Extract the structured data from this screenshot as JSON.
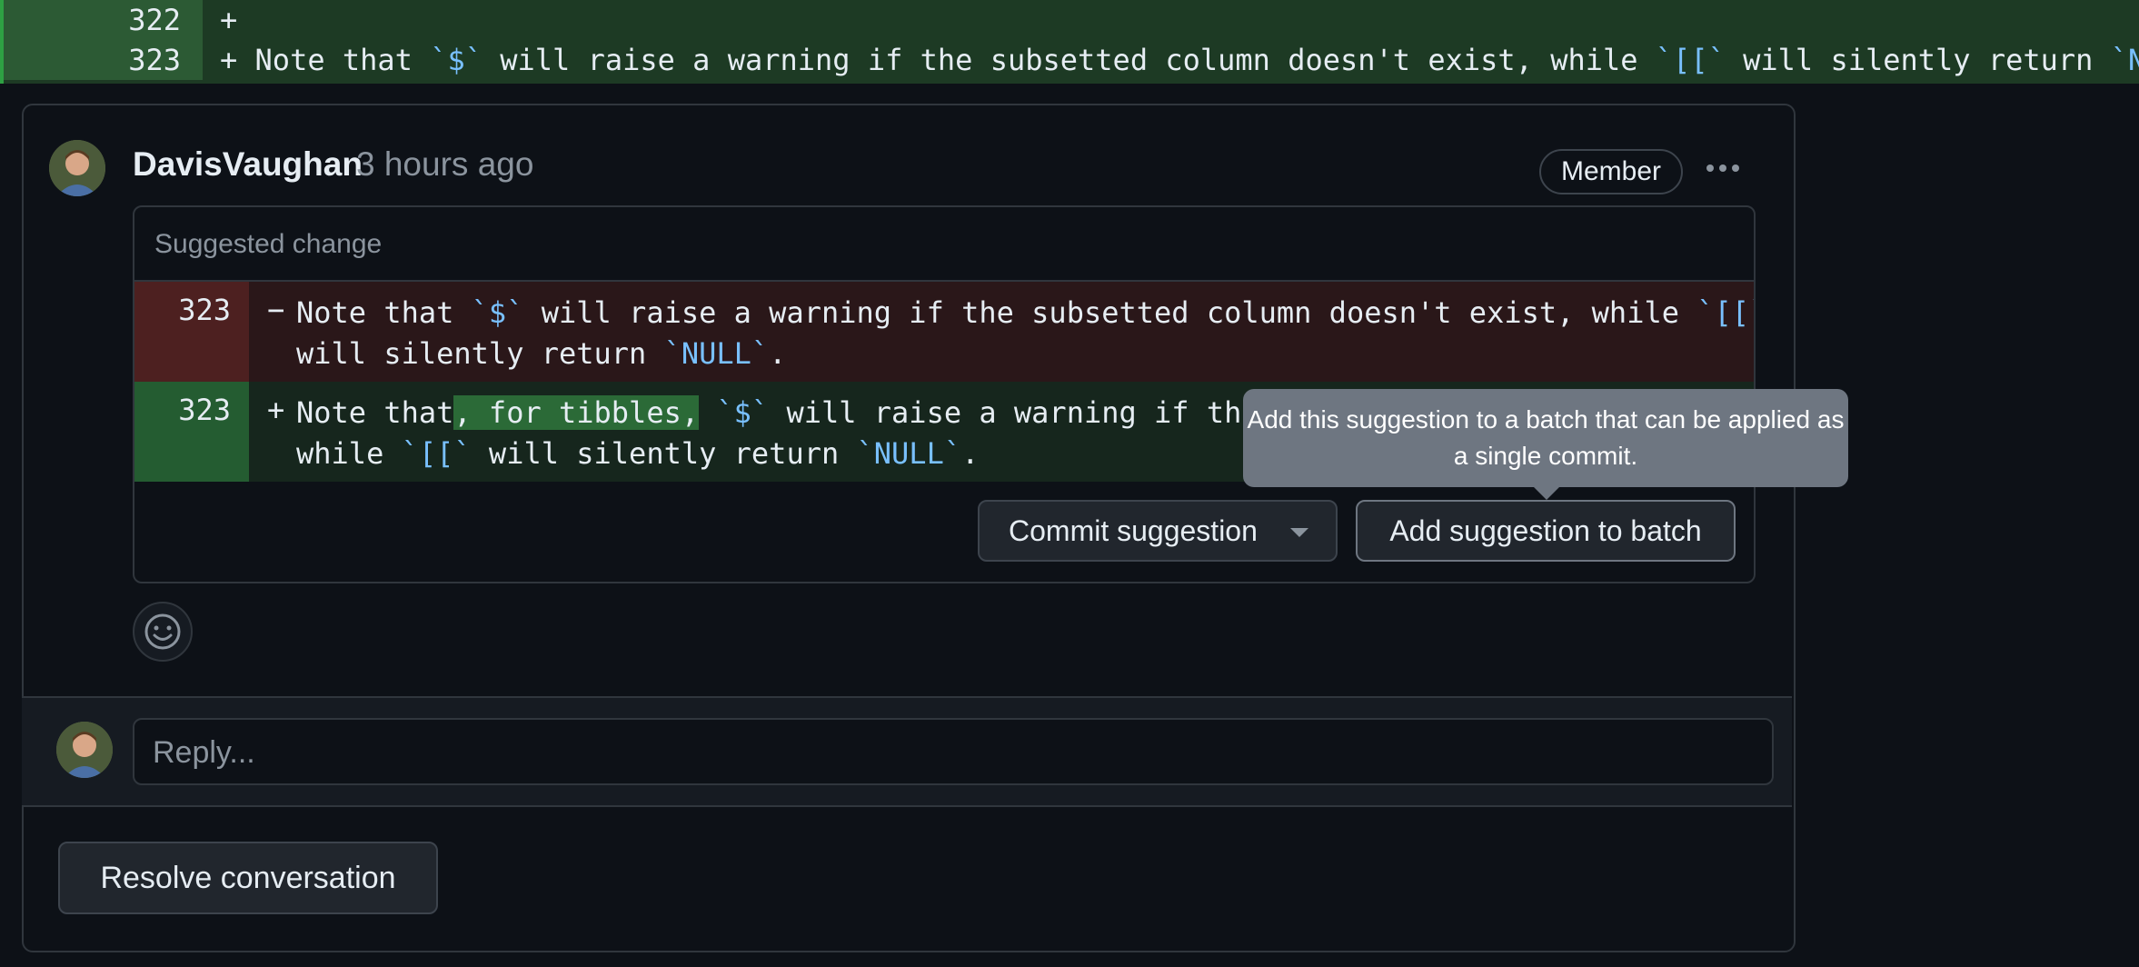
{
  "top_diff": [
    {
      "line": "322",
      "sign": "+",
      "text": ""
    },
    {
      "line": "323",
      "sign": "+",
      "text": "Note that `$` will raise a warning if the subsetted column doesn't exist, while `[[` will silently return `NULL`."
    }
  ],
  "comment": {
    "author": "DavisVaughan",
    "time": "3 hours ago",
    "badge": "Member",
    "suggestion_header": "Suggested change",
    "deleted": {
      "line": "323",
      "sign": "−",
      "line1_parts": [
        "Note that ",
        "`$`",
        " will raise a warning if the subsetted column doesn't exist, while ",
        "`[[`"
      ],
      "line2_parts": [
        "will silently return ",
        "`NULL`",
        "."
      ]
    },
    "added": {
      "line": "323",
      "sign": "+",
      "line1_parts": [
        "Note that",
        ", for tibbles,",
        " ",
        "`$`",
        " will raise a warning if the su"
      ],
      "line2_parts": [
        "while ",
        "`[[`",
        " will silently return ",
        "`NULL`",
        "."
      ]
    },
    "commit_button": "Commit suggestion",
    "batch_button": "Add suggestion to batch",
    "tooltip": "Add this suggestion to a batch that can be applied as a single commit."
  },
  "reply": {
    "placeholder": "Reply..."
  },
  "resolve_button": "Resolve conversation",
  "icons": [
    "avatar",
    "kebab-icon",
    "smiley-icon",
    "caret-down-icon"
  ]
}
